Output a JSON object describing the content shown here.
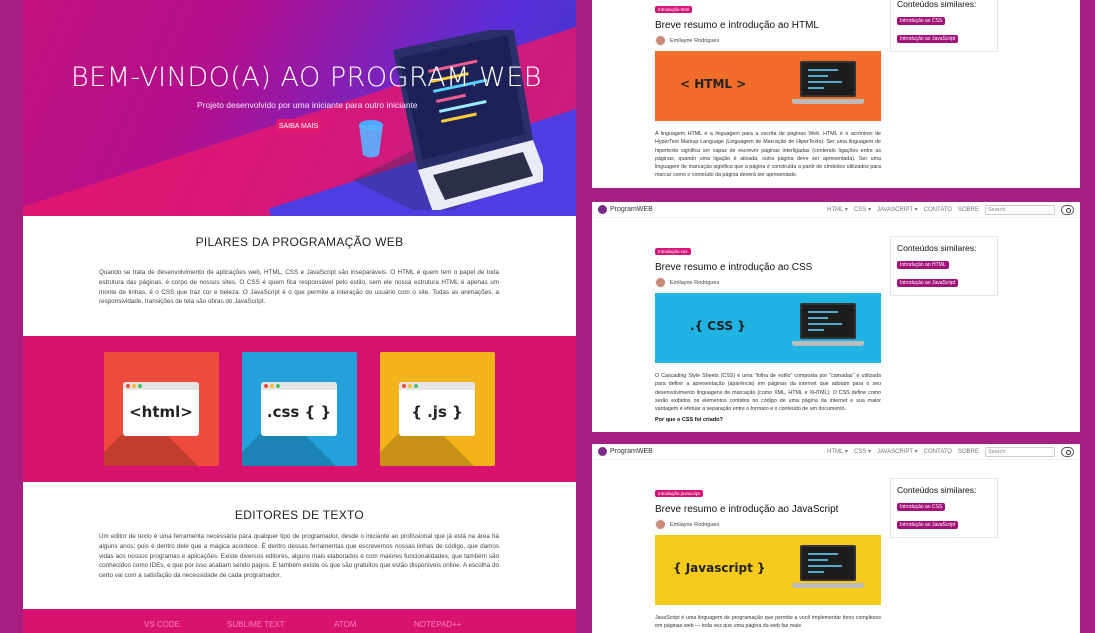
{
  "home": {
    "hero_title": "BEM-VINDO(A) AO PROGRAM.WEB",
    "hero_subtitle": "Projeto desenvolvido por uma iniciante para outro iniciante",
    "hero_button": "SAIBA MAIS",
    "pillars_title": "PILARES DA PROGRAMAÇÃO WEB",
    "pillars_text": "Quando se trata de desenvolvimento de aplicações web, HTML, CSS e JavaScript são inseparáveis. O HTML é quem tem o papel de toda estrutura das páginas, é corpo de nossos sites. O CSS é quem fica responsável pelo estilo, sem ele nossa estrutura HTML é apenas um monte de linhas, é o CSS que traz cor e beleza. O JavaScript é o que permite a interação do usuário com o site. Todas as animações, a responsividade, transições de tela são obras do JavaScript.",
    "tiles": [
      {
        "code": "<html>",
        "color": "#ef4b3c"
      },
      {
        "code": ".css { }",
        "color": "#23a1dc"
      },
      {
        "code": "{ .js }",
        "color": "#f3b31b"
      }
    ],
    "editors_title": "EDITORES DE TEXTO",
    "editors_text": "Um editor de texto é uma ferramenta necessária para qualquer tipo de programador, desde o iniciante ao profissional que já está na área há alguns anos; pois é dentro dele que a mágica acontece. É dentro dessas ferramentas que escrevemos nossas linhas de código, que damos vidas aos nossos programas e aplicações. Existe diversos editores, alguns mais elaborados e com maiores funcionalidades, que também são conhecidos como IDEs, e que por isso acabam sendo pagos. E também existe os que são gratuitos que estão disponíveis online. A escolha do certo vai com a satisfação da necessidade de cada programador.",
    "editors": [
      "VS CODE",
      "SUBLIME TEXT",
      "ATOM",
      "NOTEPAD++"
    ]
  },
  "nav": {
    "brand": "ProgramWEB",
    "items": [
      "HTML ▾",
      "CSS ▾",
      "JAVASCRIPT ▾",
      "CONTATO",
      "SOBRE"
    ],
    "search_placeholder": "Search"
  },
  "pages": [
    {
      "tag": "Introdução-html",
      "title": "Breve resumo e introdução ao HTML",
      "author": "Emilayne Rodrigues",
      "banner_label": "< HTML >",
      "banner_color": "#f26d2a",
      "text": "A linguagem HTML é a linguagem para a escrita de páginas Web. HTML é o acrônimo de HyperText Markup Language (Linguagem de Marcação de HiperTexto). Ser uma linguagem de hipertexto significa ser capaz de escrever páginas interligadas (contendo ligações entre as páginas; quando uma ligação é ativada, outra página deve ser apresentada). Ser uma linguagem de marcação significa que a página é construída a partir de símbolos utilizados para marcar como o conteúdo da página deverá ser apresentado.",
      "subheading": "",
      "similar_title": "Conteúdos similares:",
      "similar": [
        "Introdução ao CSS",
        "Introdução ao JavaScript"
      ]
    },
    {
      "tag": "Introdução-css",
      "title": "Breve resumo e introdução ao CSS",
      "author": "Emilayne Rodrigues",
      "banner_label": ".{ CSS }",
      "banner_color": "#1fb4e4",
      "text": "O Cascading Style Sheets (CSS) é uma \"folha de estilo\" composta por \"camadas\" e utilizada para definir a apresentação (aparência) em páginas da internet que adotam para o seu desenvolvimento linguagens de marcação (como XML, HTML e XHTML). O CSS define como serão exibidos os elementos contidos no código de uma página da internet e sua maior vantagem é efetuar a separação entre o formato e o conteúdo de um documento.",
      "subheading": "Por que o CSS foi criado?",
      "similar_title": "Conteúdos similares:",
      "similar": [
        "Introdução ao HTML",
        "Introdução ao JavaScript"
      ]
    },
    {
      "tag": "Introdução-javascript",
      "title": "Breve resumo e introdução ao JavaScript",
      "author": "Emilayne Rodrigues",
      "banner_label": "{ Javascript }",
      "banner_color": "#f6cb1c",
      "text": "JavaScript é uma linguagem de programação que permite a você implementar itens complexos em páginas web — toda vez que uma página da web faz mais",
      "subheading": "",
      "similar_title": "Conteúdos similares:",
      "similar": [
        "Introdução ao CSS",
        "Introdução ao JavaScript"
      ]
    }
  ]
}
